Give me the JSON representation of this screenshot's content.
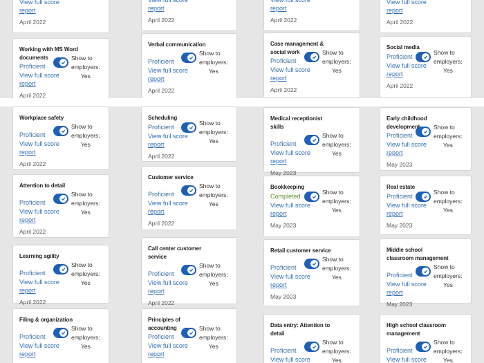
{
  "common": {
    "view_full": "View full score",
    "report": "report",
    "show_to": "Show to",
    "employers": "employers:",
    "yes": "Yes"
  },
  "top_strip": [
    {
      "title": "",
      "level": "",
      "date": "April 2022",
      "partial": true
    },
    {
      "title": "",
      "level": "",
      "date": "April 2022",
      "partial": true
    },
    {
      "title": "",
      "level": "",
      "date": "April 2022",
      "partial": true
    },
    {
      "title": "",
      "level": "",
      "date": "April 2022",
      "partial": true
    },
    {
      "title": "Working with MS Word documents",
      "level": "Proficient",
      "date": "April 2022"
    },
    {
      "title": "Verbal communication",
      "level": "Proficient",
      "date": "April 2022"
    },
    {
      "title": "Case management & social work",
      "level": "Proficient",
      "date": "April 2022"
    },
    {
      "title": "Social media",
      "level": "Proficient",
      "date": "April 2022"
    }
  ],
  "bottom_strip": [
    {
      "title": "Workplace safety",
      "level": "Proficient",
      "date": "April 2022"
    },
    {
      "title": "Scheduling",
      "level": "Proficient",
      "date": "April 2022"
    },
    {
      "title": "Medical receptionist skills",
      "level": "Proficient",
      "date": "May 2023"
    },
    {
      "title": "Early childhood development",
      "level": "Proficient",
      "date": "May 2023"
    },
    {
      "title": "Attention to detail",
      "level": "Proficient",
      "date": "April 2022"
    },
    {
      "title": "Customer service",
      "level": "Proficient",
      "date": "April 2022"
    },
    {
      "title": "Bookkeeping",
      "level": "Completed",
      "date": "May 2023"
    },
    {
      "title": "Real estate",
      "level": "Proficient",
      "date": "May 2023"
    },
    {
      "title": "Learning agility",
      "level": "Proficient",
      "date": "April 2022"
    },
    {
      "title": "Call center customer service",
      "level": "Proficient",
      "date": "April 2022"
    },
    {
      "title": "Retail customer service",
      "level": "Proficient",
      "date": "May 2023"
    },
    {
      "title": "Middle school classroom management",
      "level": "Proficient",
      "date": "May 2023"
    },
    {
      "title": "Filing & organization",
      "level": "Proficient",
      "date": ""
    },
    {
      "title": "Principles of accounting",
      "level": "Proficient",
      "date": ""
    },
    {
      "title": "Data entry: Attention to detail",
      "level": "Proficient",
      "date": ""
    },
    {
      "title": "High school classroom management",
      "level": "Proficient",
      "date": ""
    }
  ],
  "colors": {
    "toggle": "#1e5fb8",
    "link": "#2f6db5",
    "proficient": "#3a6ea5",
    "completed": "#5b8f2e"
  }
}
